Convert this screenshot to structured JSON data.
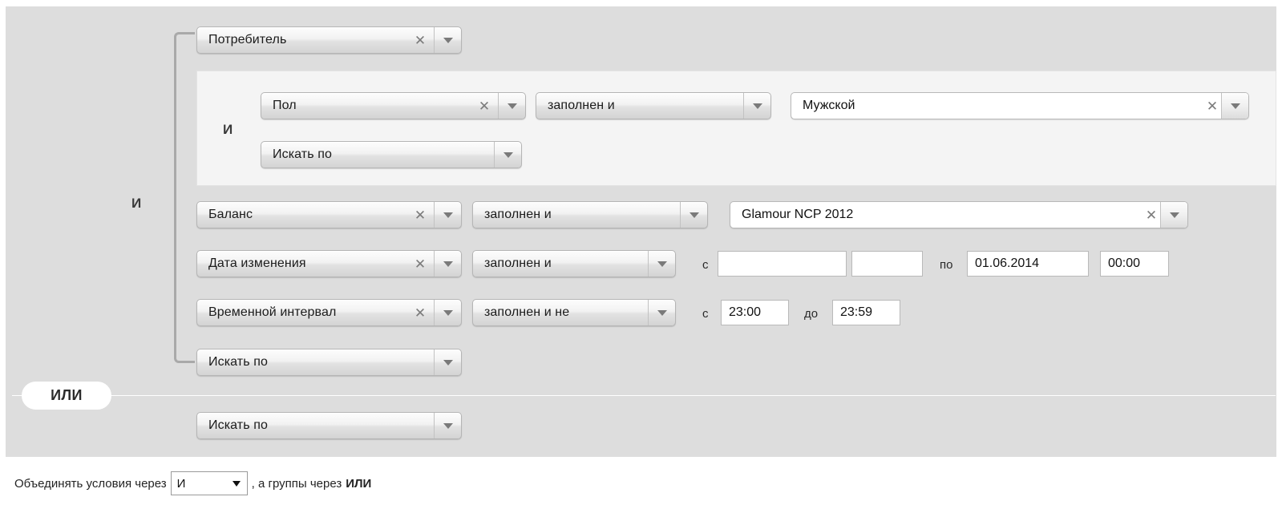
{
  "footer": {
    "prefix": "Объединять условия через",
    "operator_selected": "И",
    "operator_options": [
      "И",
      "ИЛИ"
    ],
    "suffix": ", а группы через",
    "group_operator": "ИЛИ"
  },
  "separator": {
    "or_label": "ИЛИ"
  },
  "group": {
    "conjunction": "И",
    "inner_conjunction": "И",
    "rows": {
      "consumer": {
        "field": "Потребитель",
        "clear": "✕"
      },
      "gender": {
        "field": "Пол",
        "clear": "✕",
        "operator": "заполнен и",
        "value": "Мужской",
        "value_clear": "✕"
      },
      "search_by_inner": {
        "field": "Искать по"
      },
      "balance": {
        "field": "Баланс",
        "clear": "✕",
        "operator": "заполнен и",
        "value": "Glamour NCP 2012",
        "value_clear": "✕"
      },
      "change_date": {
        "field": "Дата изменения",
        "clear": "✕",
        "operator": "заполнен и",
        "from_label": "с",
        "from_date": "",
        "from_time": "",
        "to_label": "по",
        "to_date": "01.06.2014",
        "to_time": "00:00"
      },
      "time_interval": {
        "field": "Временной интервал",
        "clear": "✕",
        "operator": "заполнен и не",
        "from_label": "с",
        "from_time": "23:00",
        "to_label": "до",
        "to_time": "23:59"
      },
      "search_by_group": {
        "field": "Искать по"
      }
    }
  },
  "second_group": {
    "search_by": {
      "field": "Искать по"
    }
  }
}
